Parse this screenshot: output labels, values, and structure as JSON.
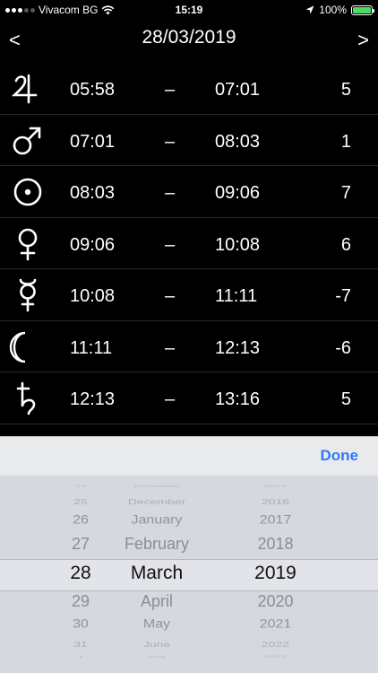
{
  "status_bar": {
    "carrier": "Vivacom BG",
    "time": "15:19",
    "battery": "100%",
    "battery_level": 1.0
  },
  "header": {
    "prev": "<",
    "date": "28/03/2019",
    "next": ">"
  },
  "hours": [
    {
      "planet": "jupiter",
      "start": "05:58",
      "end": "07:01",
      "value": "5"
    },
    {
      "planet": "mars",
      "start": "07:01",
      "end": "08:03",
      "value": "1"
    },
    {
      "planet": "sun",
      "start": "08:03",
      "end": "09:06",
      "value": "7"
    },
    {
      "planet": "venus",
      "start": "09:06",
      "end": "10:08",
      "value": "6"
    },
    {
      "planet": "mercury",
      "start": "10:08",
      "end": "11:11",
      "value": "-7"
    },
    {
      "planet": "moon",
      "start": "11:11",
      "end": "12:13",
      "value": "-6"
    },
    {
      "planet": "saturn",
      "start": "12:13",
      "end": "13:16",
      "value": "5"
    }
  ],
  "separator": "–",
  "picker": {
    "done_label": "Done",
    "days": [
      "24",
      "25",
      "26",
      "27",
      "28",
      "29",
      "30",
      "31",
      "1"
    ],
    "months": [
      "November",
      "December",
      "January",
      "February",
      "March",
      "April",
      "May",
      "June",
      "July"
    ],
    "years": [
      "2015",
      "2016",
      "2017",
      "2018",
      "2019",
      "2020",
      "2021",
      "2022",
      "2023"
    ],
    "selected": {
      "day": "28",
      "month": "March",
      "year": "2019"
    }
  },
  "colors": {
    "accent": "#3478f6",
    "battery": "#4cd964"
  }
}
